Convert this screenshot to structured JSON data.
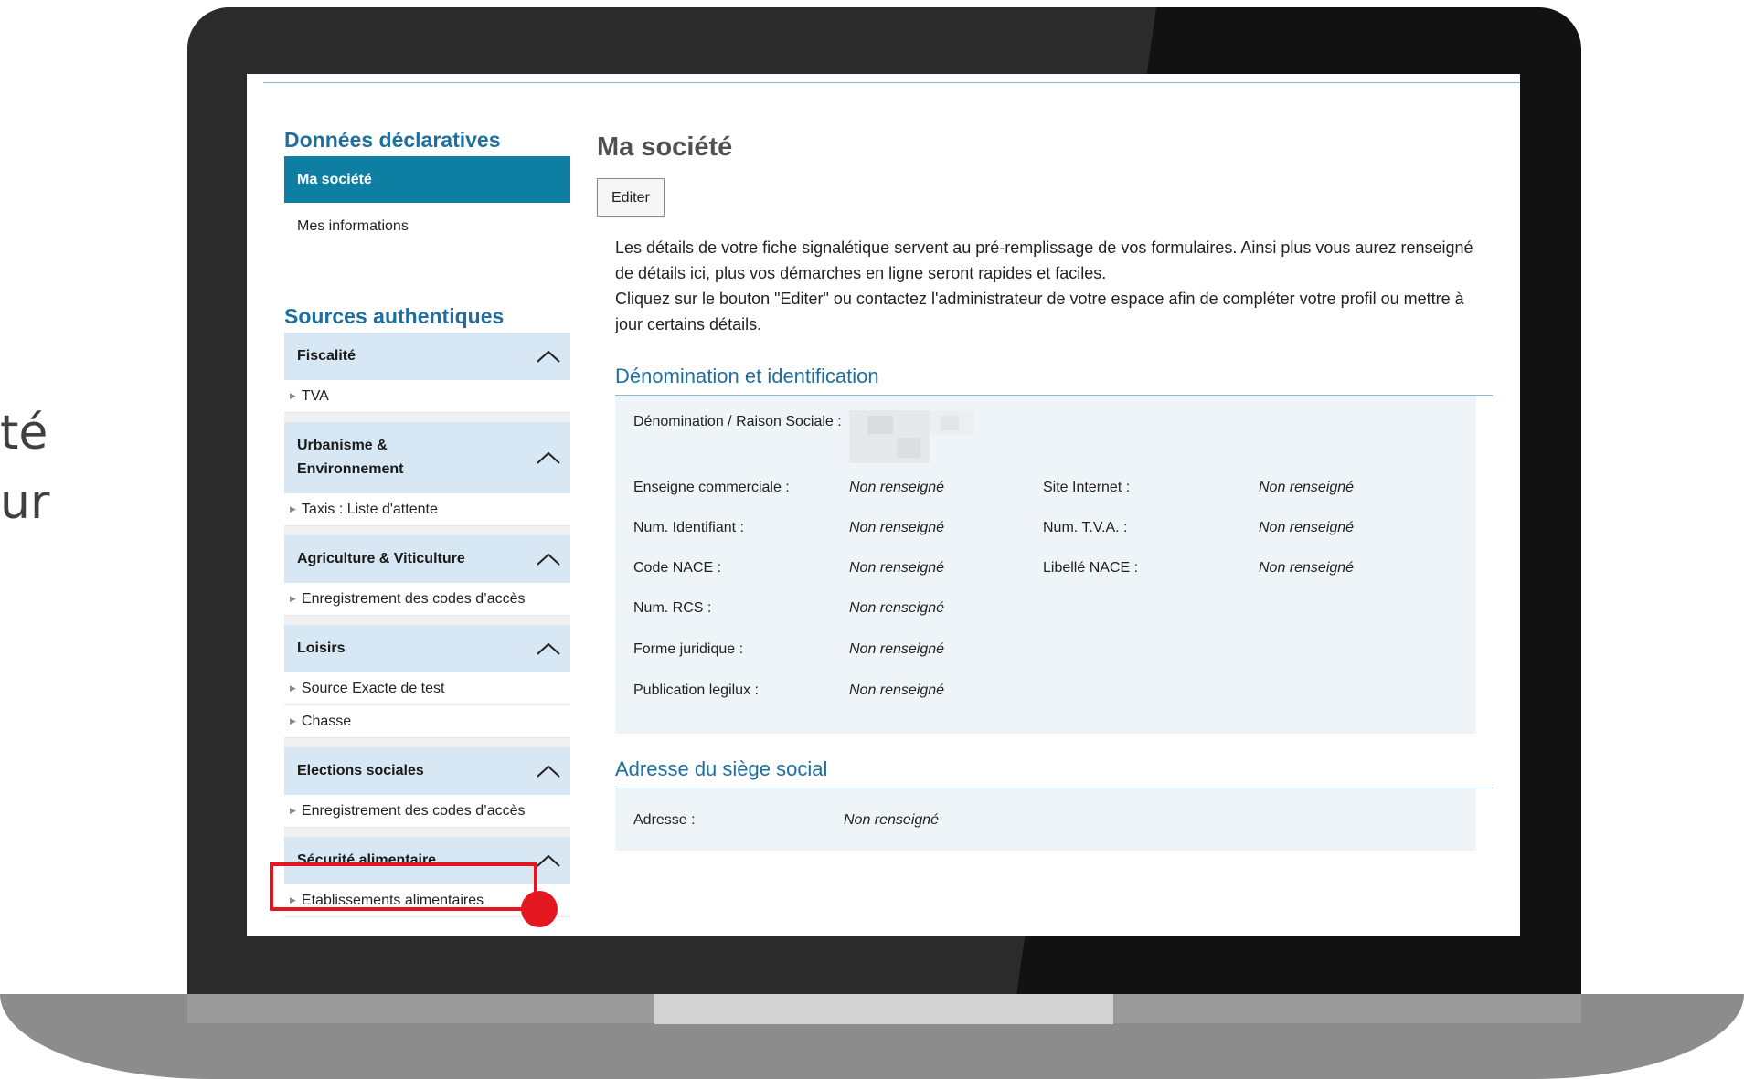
{
  "edge_text": {
    "line1": "té",
    "line2": "ur"
  },
  "sidebar": {
    "section1_title": "Données déclaratives",
    "items": [
      {
        "label": "Ma société",
        "active": true
      },
      {
        "label": "Mes informations",
        "active": false
      }
    ],
    "section2_title": "Sources authentiques",
    "categories": [
      {
        "label": "Fiscalité",
        "subs": [
          "TVA"
        ]
      },
      {
        "label": "Urbanisme & Environnement",
        "subs": [
          "Taxis : Liste d'attente"
        ]
      },
      {
        "label": "Agriculture & Viticulture",
        "subs": [
          "Enregistrement des codes d’accès"
        ]
      },
      {
        "label": "Loisirs",
        "subs": [
          "Source Exacte de test",
          "Chasse"
        ]
      },
      {
        "label": "Elections sociales",
        "subs": [
          "Enregistrement des codes d’accès"
        ]
      },
      {
        "label": "Sécurité alimentaire",
        "subs": [
          "Etablissements alimentaires"
        ]
      }
    ]
  },
  "main": {
    "title": "Ma société",
    "edit_label": "Editer",
    "intro_p1": "Les détails de votre fiche signalétique servent au pré-remplissage de vos formulaires. Ainsi plus vous aurez renseigné de détails ici, plus vos démarches en ligne seront rapides et faciles.",
    "intro_p2": "Cliquez sur le bouton \"Editer\" ou contactez l'administrateur de votre espace afin de compléter votre profil ou mettre à jour certains détails.",
    "identification": {
      "title": "Dénomination et identification",
      "denomination_label": "Dénomination / Raison Sociale :",
      "rows": [
        {
          "label": "Enseigne commerciale :",
          "value": "Non renseigné",
          "label2": "Site Internet :",
          "value2": "Non renseigné"
        },
        {
          "label": "Num. Identifiant :",
          "value": "Non renseigné",
          "label2": "Num. T.V.A. :",
          "value2": "Non renseigné"
        },
        {
          "label": "Code NACE :",
          "value": "Non renseigné",
          "label2": "Libellé NACE :",
          "value2": "Non renseigné"
        },
        {
          "label": "Num. RCS :",
          "value": "Non renseigné"
        },
        {
          "label": "Forme juridique :",
          "value": "Non renseigné"
        },
        {
          "label": "Publication legilux :",
          "value": "Non renseigné"
        }
      ]
    },
    "address": {
      "title": "Adresse du siège social",
      "label": "Adresse :",
      "value": "Non renseigné"
    }
  },
  "colors": {
    "accent": "#0e7fa3",
    "heading_blue": "#1e6fa0",
    "category_bg": "#d7e7f3",
    "panel_bg": "#eef4f8",
    "highlight_red": "#e4161f"
  },
  "icons": {
    "category_toggle": "chevron-up-icon",
    "sub_bullet": "triangle-right-icon"
  }
}
